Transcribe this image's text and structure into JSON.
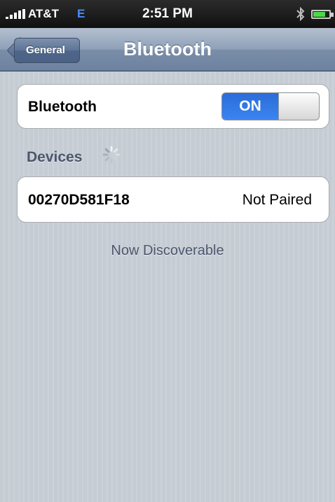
{
  "status_bar": {
    "carrier": "AT&T",
    "network": "E",
    "time": "2:51 PM",
    "icons": [
      "signal-icon",
      "bluetooth-icon",
      "battery-icon"
    ]
  },
  "nav": {
    "back_label": "General",
    "title": "Bluetooth"
  },
  "bluetooth": {
    "label": "Bluetooth",
    "toggle_state": "ON"
  },
  "devices": {
    "header": "Devices",
    "items": [
      {
        "name": "00270D581F18",
        "status": "Not Paired"
      }
    ]
  },
  "footer": {
    "text": "Now Discoverable"
  },
  "colors": {
    "toggle_on": "#2b6cd8",
    "network_badge": "#4a8cff",
    "section_text": "#4c566c"
  }
}
